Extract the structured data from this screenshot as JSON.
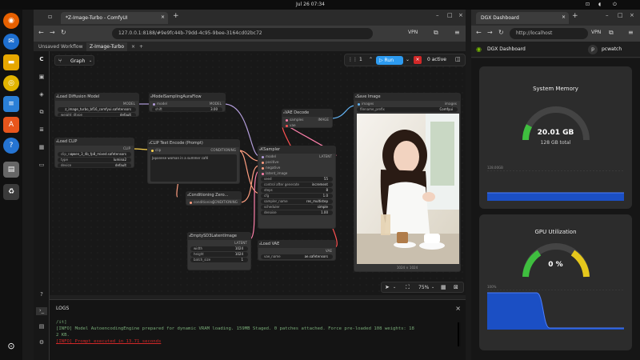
{
  "system": {
    "clock": "Jul 26  07:34"
  },
  "win1": {
    "tab_title": "*Z-Image-Turbo - ComfyUI",
    "url": "127.0.0.1:8188/#9e9fc44b-79dd-4c95-9bee-3164cd02bc72",
    "vpn": "VPN",
    "wf_tabs": [
      "Unsaved Workflow",
      "Z-Image-Turbo"
    ],
    "graph_label": "Graph",
    "queue_count": "1",
    "run_label": "Run",
    "active_label": "0 active",
    "zoom": "75%",
    "logs_title": "LOGS",
    "logs": [
      "/it]",
      "[INFO] Model AutoencodingEngine prepared for dynamic VRAM loading. 159MB Staged. 0 patches attached. Force pre-loaded 108 weights: 18",
      "2 KB.",
      "[INFO] Prompt executed in 13.71 seconds"
    ],
    "nodes": {
      "load_diffusion": {
        "title": "Load Diffusion Model",
        "out": "MODEL",
        "unet": "z_image_turbo_bf16_comfyui.safetensors",
        "dtype_k": "weight_dtype",
        "dtype_v": "default"
      },
      "model_sampling": {
        "title": "ModelSamplingAuraFlow",
        "in": "model",
        "out": "MODEL",
        "shift_k": "shift",
        "shift_v": "3.00"
      },
      "load_clip": {
        "title": "Load CLIP",
        "out": "CLIP",
        "clip_k": "clip_na",
        "clip_v": "qwen_3_4b_fp8_mixed.safetensors",
        "type_k": "type",
        "type_v": "lumina2",
        "dev_k": "device",
        "dev_v": "default"
      },
      "clip_text": {
        "title": "CLIP Text Encode (Prompt)",
        "in": "clip",
        "out": "CONDITIONING",
        "text": "Japanese woman in a summer café"
      },
      "cond_zero": {
        "title": "Conditioning Zero...",
        "in": "conditioning",
        "out": "CONDITIONING"
      },
      "vae_decode": {
        "title": "VAE Decode",
        "in1": "samples",
        "in2": "vae",
        "out": "IMAGE"
      },
      "ksampler": {
        "title": "KSampler",
        "out": "LATENT",
        "inputs": [
          "model",
          "positive",
          "negative",
          "latent_image"
        ],
        "widgets": [
          [
            "seed",
            "55"
          ],
          [
            "control after generate",
            "increment"
          ],
          [
            "steps",
            "8"
          ],
          [
            "cfg",
            "1.0"
          ],
          [
            "sampler_name",
            "res_multistep"
          ],
          [
            "scheduler",
            "simple"
          ],
          [
            "denoise",
            "1.00"
          ]
        ]
      },
      "save_image": {
        "title": "Save Image",
        "in": "images",
        "tag": "images",
        "prefix_k": "filename_prefix",
        "prefix_v": "Comfyui",
        "size": "1024 × 1024"
      },
      "empty_latent": {
        "title": "EmptySD3LatentImage",
        "out": "LATENT",
        "widgets": [
          [
            "width",
            "1024"
          ],
          [
            "height",
            "1024"
          ],
          [
            "batch_size",
            "1"
          ]
        ]
      },
      "load_vae": {
        "title": "Load VAE",
        "out": "VAE",
        "k": "vae_name",
        "v": "ae.safetensors"
      }
    }
  },
  "win2": {
    "tab_title": "DGX Dashboard",
    "url": "http://localhost",
    "vpn": "VPN",
    "app_title": "DGX Dashboard",
    "user": "pcwatch",
    "user_initial": "p",
    "mem_title": "System Memory",
    "mem_value": "20.01 GB",
    "mem_total": "128 GB total",
    "mem_fraction": 0.156,
    "mem_axis": "128.00GB",
    "gpu_title": "GPU Utilization",
    "gpu_value": "0 %",
    "gpu_fraction": 0.0,
    "gpu_axis": "100%"
  },
  "colors": {
    "run": "#2d9bf0",
    "accent_red": "#d12828",
    "gauge_green": "#3fbf3f",
    "gauge_yellow": "#e6c81c",
    "chart_blue": "#1b4fc4"
  }
}
